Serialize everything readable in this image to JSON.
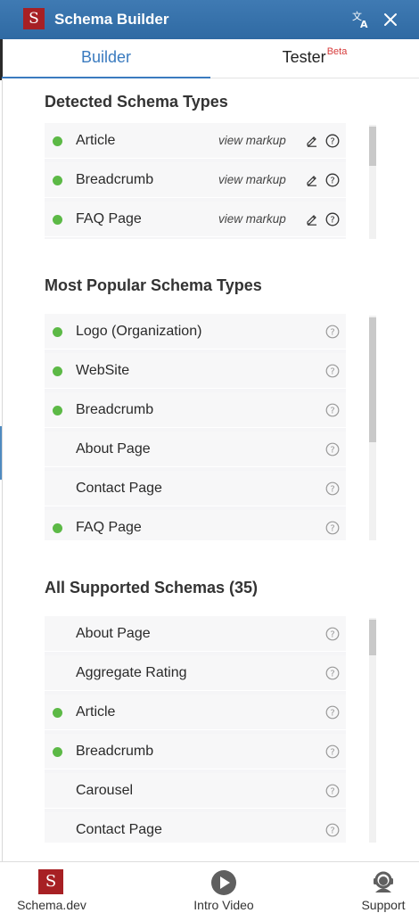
{
  "header": {
    "logo_letter": "S",
    "title": "Schema Builder"
  },
  "tabs": [
    {
      "label": "Builder",
      "active": true
    },
    {
      "label": "Tester",
      "badge": "Beta",
      "active": false
    }
  ],
  "detected": {
    "title": "Detected Schema Types",
    "view_markup_label": "view markup",
    "items": [
      {
        "label": "Article",
        "active": true
      },
      {
        "label": "Breadcrumb",
        "active": true
      },
      {
        "label": "FAQ Page",
        "active": true
      }
    ]
  },
  "popular": {
    "title": "Most Popular Schema Types",
    "items": [
      {
        "label": "Logo (Organization)",
        "active": true
      },
      {
        "label": "WebSite",
        "active": true
      },
      {
        "label": "Breadcrumb",
        "active": true
      },
      {
        "label": "About Page",
        "active": false
      },
      {
        "label": "Contact Page",
        "active": false
      },
      {
        "label": "FAQ Page",
        "active": true
      }
    ]
  },
  "supported": {
    "title": "All Supported Schemas (35)",
    "items": [
      {
        "label": "About Page",
        "active": false
      },
      {
        "label": "Aggregate Rating",
        "active": false
      },
      {
        "label": "Article",
        "active": true
      },
      {
        "label": "Breadcrumb",
        "active": true
      },
      {
        "label": "Carousel",
        "active": false
      },
      {
        "label": "Contact Page",
        "active": false
      }
    ]
  },
  "footer": {
    "schema_dev": "Schema.dev",
    "intro_video": "Intro Video",
    "support": "Support"
  },
  "colors": {
    "header_bg": "#2f6aa3",
    "accent": "#3a7bbf",
    "active_dot": "#5cb946",
    "brand_red": "#a72024",
    "beta": "#d63a3a"
  },
  "icons": {
    "translate": "translate-icon",
    "close": "close-icon",
    "edit": "pencil-icon",
    "help": "question-circle-icon",
    "play": "play-circle-icon",
    "support": "headset-icon"
  }
}
